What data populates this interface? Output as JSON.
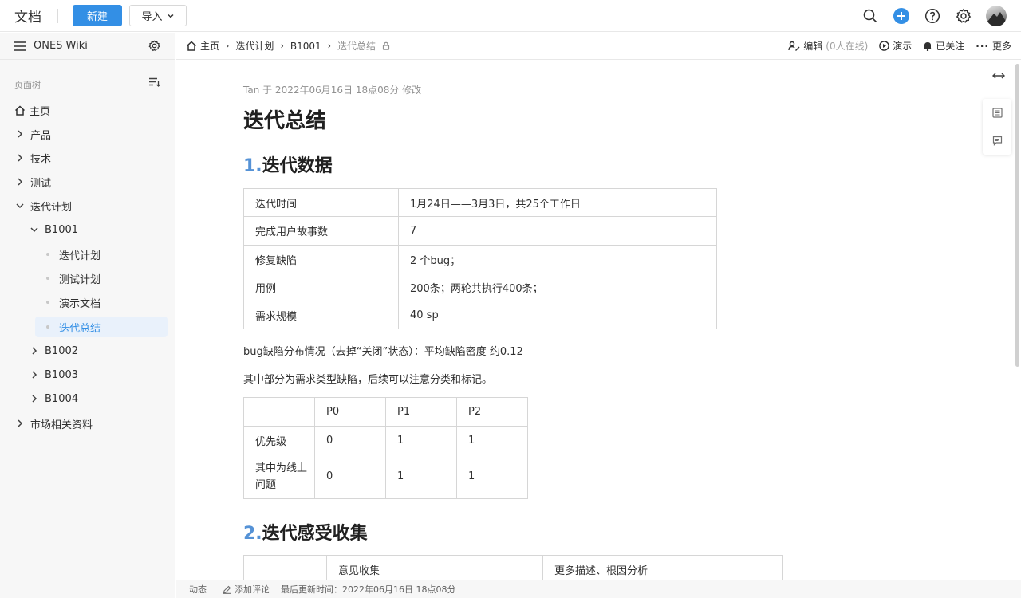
{
  "topbar": {
    "app_title": "文档",
    "new_button": "新建",
    "import_button": "导入"
  },
  "sidebar": {
    "wiki_name": "ONES Wiki",
    "tree_label": "页面树",
    "items": [
      {
        "label": "主页"
      },
      {
        "label": "产品"
      },
      {
        "label": "技术"
      },
      {
        "label": "测试"
      },
      {
        "label": "迭代计划"
      },
      {
        "label": "B1001"
      },
      {
        "label": "迭代计划"
      },
      {
        "label": "测试计划"
      },
      {
        "label": "演示文档"
      },
      {
        "label": "迭代总结"
      },
      {
        "label": "B1002"
      },
      {
        "label": "B1003"
      },
      {
        "label": "B1004"
      },
      {
        "label": "市场相关资料"
      }
    ]
  },
  "breadcrumb": {
    "items": [
      "主页",
      "迭代计划",
      "B1001",
      "迭代总结"
    ]
  },
  "actions": {
    "edit": "编辑",
    "online": "(0人在线)",
    "present": "演示",
    "follow": "已关注",
    "more": "更多"
  },
  "doc": {
    "meta": "Tan 于 2022年06月16日 18点08分 修改",
    "title": "迭代总结",
    "section1_num": "1.",
    "section1_title": "迭代数据",
    "table1": [
      [
        "迭代时间",
        "1月24日——3月3日，共25个工作日"
      ],
      [
        "完成用户故事数",
        "7"
      ],
      [
        "修复缺陷",
        "2 个bug；"
      ],
      [
        "用例",
        "200条；两轮共执行400条；"
      ],
      [
        "需求规模",
        "40 sp"
      ]
    ],
    "para1": "bug缺陷分布情况（去掉“关闭”状态）：平均缺陷密度 约0.12",
    "para2": "其中部分为需求类型缺陷，后续可以注意分类和标记。",
    "table2": {
      "header": [
        "",
        "P0",
        "P1",
        "P2"
      ],
      "rows": [
        [
          "优先级",
          "0",
          "1",
          "1"
        ],
        [
          "其中为线上问题",
          "0",
          "1",
          "1"
        ]
      ]
    },
    "section2_num": "2.",
    "section2_title": "迭代感受收集",
    "table3_header": [
      "",
      "意见收集",
      "更多描述、根因分析"
    ]
  },
  "footer": {
    "activity": "动态",
    "add_comment": "添加评论",
    "last_updated": "最后更新时间：2022年06月16日 18点08分"
  }
}
